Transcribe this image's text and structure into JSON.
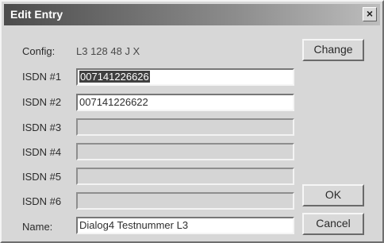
{
  "window": {
    "title": "Edit Entry",
    "close_glyph": "×"
  },
  "config": {
    "label": "Config:",
    "value": "L3    128 48 J X"
  },
  "isdn": [
    {
      "label": "ISDN #1",
      "value": "007141226626"
    },
    {
      "label": "ISDN #2",
      "value": "007141226622"
    },
    {
      "label": "ISDN #3",
      "value": ""
    },
    {
      "label": "ISDN #4",
      "value": ""
    },
    {
      "label": "ISDN #5",
      "value": ""
    },
    {
      "label": "ISDN #6",
      "value": ""
    }
  ],
  "name": {
    "label": "Name:",
    "value": "Dialog4 Testnummer L3"
  },
  "buttons": {
    "change": "Change",
    "ok": "OK",
    "cancel": "Cancel"
  }
}
